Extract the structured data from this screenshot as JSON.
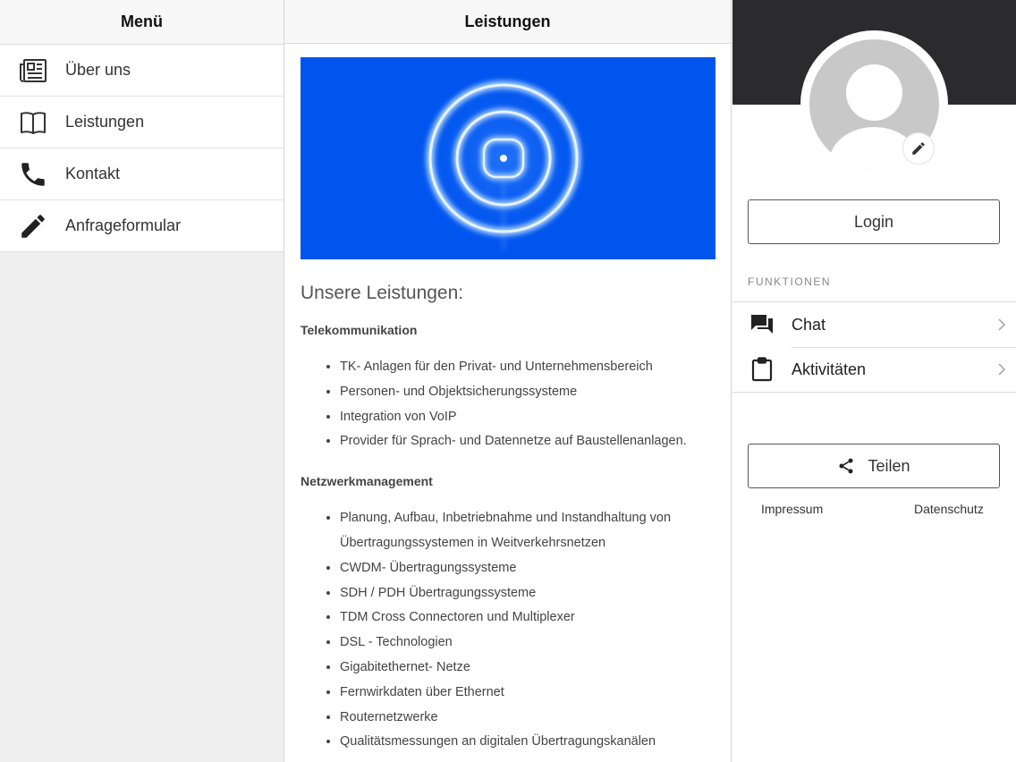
{
  "left_menu": {
    "title": "Menü",
    "items": [
      {
        "label": "Über uns",
        "icon": "newspaper-icon"
      },
      {
        "label": "Leistungen",
        "icon": "book-icon"
      },
      {
        "label": "Kontakt",
        "icon": "phone-icon"
      },
      {
        "label": "Anfrageformular",
        "icon": "pencil-icon"
      }
    ]
  },
  "main": {
    "title": "Leistungen",
    "heading": "Unsere Leistungen:",
    "sections": [
      {
        "title": "Telekommunikation",
        "items": [
          "TK- Anlagen für den Privat- und Unternehmensbereich",
          "Personen- und Objektsicherungssysteme",
          "Integration von VoIP",
          "Provider für Sprach- und Datennetze auf Baustellenanlagen."
        ]
      },
      {
        "title": "Netzwerkmanagement",
        "items": [
          "Planung, Aufbau, Inbetriebnahme und Instandhaltung von Übertragungssystemen in Weitverkehrsnetzen",
          "CWDM- Übertragungssysteme",
          "SDH / PDH Übertragungssysteme",
          "TDM Cross Connectoren und Multiplexer",
          "DSL - Technologien",
          "Gigabitethernet- Netze",
          "Fernwirkdaten über Ethernet",
          "Routernetzwerke",
          "Qualitätsmessungen an digitalen Übertragungskanälen"
        ]
      }
    ]
  },
  "right_panel": {
    "login_label": "Login",
    "functions_label": "FUNKTIONEN",
    "functions": [
      {
        "label": "Chat",
        "icon": "chat-icon"
      },
      {
        "label": "Aktivitäten",
        "icon": "clipboard-icon"
      }
    ],
    "share_label": "Teilen",
    "impressum_label": "Impressum",
    "datenschutz_label": "Datenschutz"
  },
  "colors": {
    "banner_blue": "#0055ee",
    "cover_dark": "#2b2b2d"
  }
}
